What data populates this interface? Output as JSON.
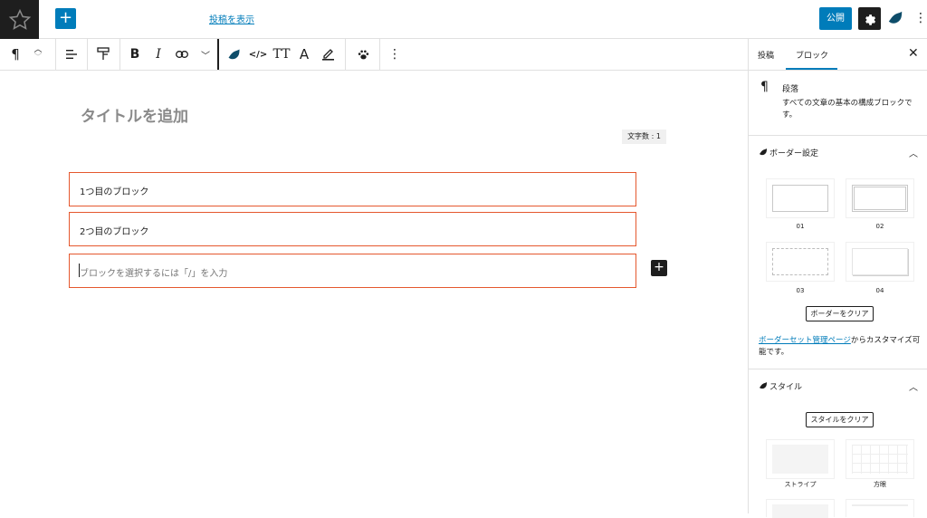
{
  "topbar": {
    "view_post_link": "投稿を表示",
    "publish_label": "公開"
  },
  "toolbar": {
    "paragraph_symbol": "¶",
    "bold": "B",
    "italic": "I",
    "code": "</>",
    "font_size": "TT",
    "text_color": "A"
  },
  "sidebar": {
    "tabs": [
      "投稿",
      "ブロック"
    ],
    "active_tab": "ブロック",
    "block_card": {
      "icon": "¶",
      "title": "段落",
      "description": "すべての文章の基本の構成ブロックです。"
    },
    "border_panel": {
      "title": "ボーダー設定",
      "options": [
        "01",
        "02",
        "03",
        "04"
      ],
      "clear_button": "ボーダーをクリア",
      "link_text": "ボーダーセット管理ページ",
      "trailing_text": "からカスタマイズ可能です。"
    },
    "style_panel": {
      "title": "スタイル",
      "clear_button": "スタイルをクリア",
      "options": [
        "ストライプ",
        "方眼"
      ]
    }
  },
  "editor": {
    "title_placeholder": "タイトルを追加",
    "word_count": "文字数 : 1",
    "blocks": [
      "1つ目のブロック",
      "2つ目のブロック"
    ],
    "empty_block_placeholder": "ブロックを選択するには「/」を入力"
  },
  "colors": {
    "accent": "#007cba",
    "block_border": "#e5582e",
    "dark": "#1e1e1e"
  }
}
